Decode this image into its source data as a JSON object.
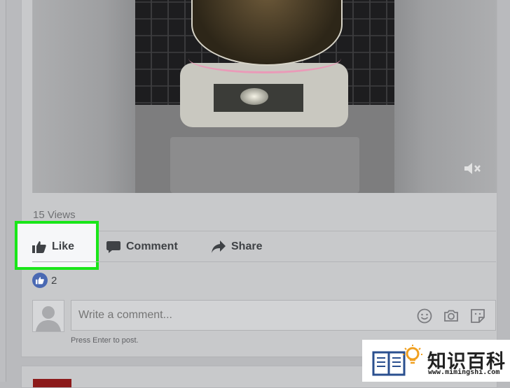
{
  "post": {
    "views_text": "15 Views",
    "actions": {
      "like_label": "Like",
      "comment_label": "Comment",
      "share_label": "Share"
    },
    "reactions": {
      "count": "2",
      "icon": "thumbs-up-icon"
    },
    "comment_composer": {
      "placeholder": "Write a comment...",
      "hint": "Press Enter to post."
    },
    "video": {
      "muted": true,
      "icon": "speaker-muted-icon"
    }
  },
  "watermark": {
    "text": "知识百科",
    "url": "www.mimingshi.com"
  },
  "colors": {
    "highlight": "#19e619",
    "like_badge": "#4a69b3",
    "overlay": "#c8c9cb"
  }
}
